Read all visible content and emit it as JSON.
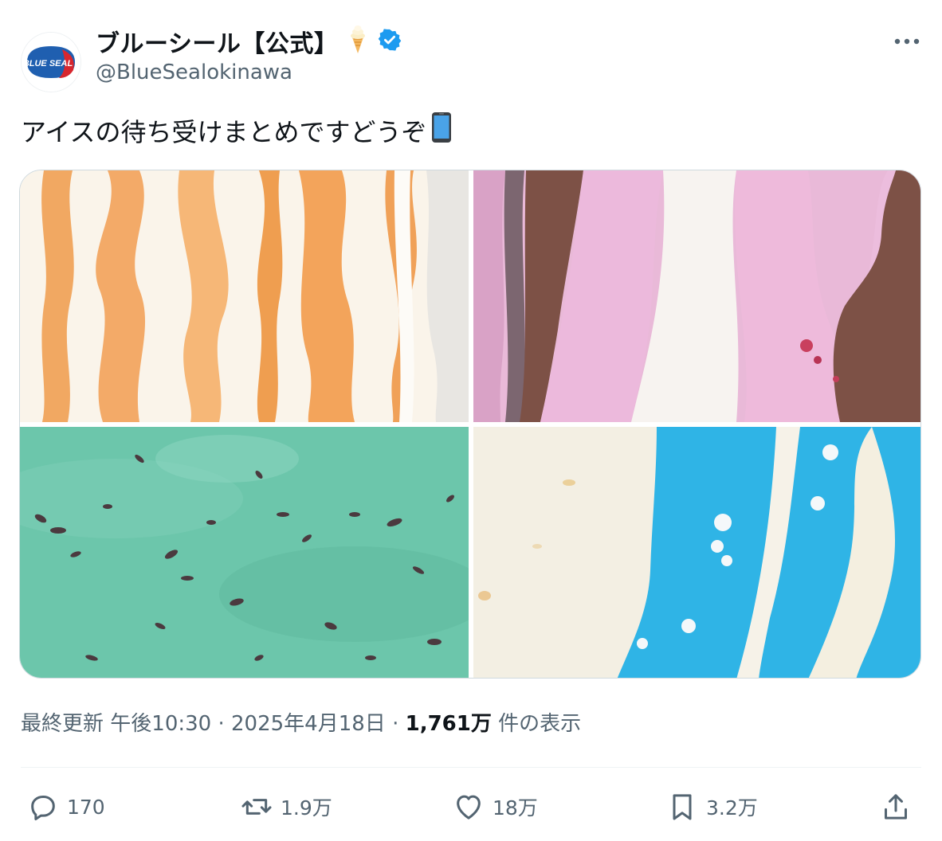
{
  "author": {
    "display_name": "ブルーシール【公式】",
    "handle": "@BlueSealokinawa",
    "logo_text": "BLUE SEAL",
    "verified": true,
    "badge_icon": "soft-serve-icon"
  },
  "tweet": {
    "text": "アイスの待ち受けまとめですどうぞ",
    "emoji_icon": "mobile-phone-icon"
  },
  "media": {
    "images": [
      "orange-swirl",
      "pink-chocolate-stripes",
      "mint-chocolate-chip",
      "blue-white-swirl"
    ]
  },
  "meta": {
    "prefix": "最終更新",
    "time": "午後10:30",
    "sep": "·",
    "date": "2025年4月18日",
    "views": "1,761万",
    "views_suffix": "件の表示"
  },
  "actions": {
    "reply": "170",
    "retweet": "1.9万",
    "like": "18万",
    "bookmark": "3.2万"
  },
  "colors": {
    "text": "#0f1419",
    "secondary": "#536471",
    "verified": "#1d9bf0",
    "brand_blue": "#1f5fb0",
    "brand_red": "#d7262e"
  }
}
